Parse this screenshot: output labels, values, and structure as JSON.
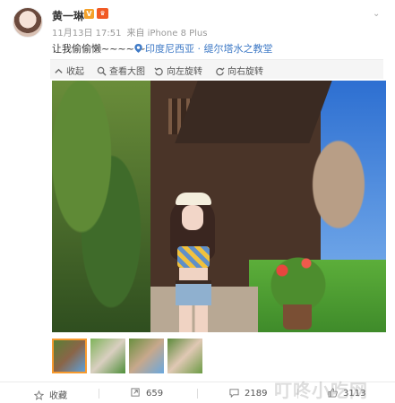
{
  "post": {
    "username": "黄一琳",
    "verified_badge": "V",
    "vip_badge": "会员",
    "timestamp": "11月13日 17:51",
    "source": "来自 iPhone 8 Plus",
    "text": "让我偷偷懒~~~~ ~",
    "location": "印度尼西亚 · 缇尔塔水之教堂"
  },
  "toolbar": {
    "collapse_label": "收起",
    "view_large_label": "查看大图",
    "rotate_left_label": "向左旋转",
    "rotate_right_label": "向右旋转"
  },
  "thumbnails": {
    "count": 4,
    "selected_index": 0
  },
  "footer": {
    "favorite_label": "收藏",
    "repost_count": "659",
    "comment_count": "2189",
    "like_count": "3113"
  },
  "watermark": "叮咚小吃网",
  "colors": {
    "link_blue": "#3f7ac6",
    "selected_border": "#f79a2e",
    "vip_orange": "#f15a24"
  }
}
